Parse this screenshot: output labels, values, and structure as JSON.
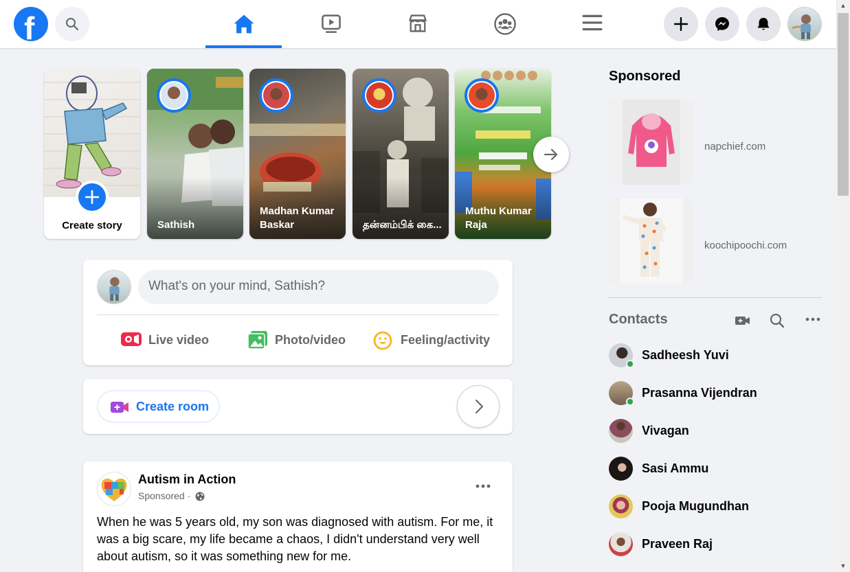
{
  "topbar": {
    "logo_letter": "f",
    "nav": [
      {
        "name": "home",
        "active": true
      },
      {
        "name": "watch",
        "active": false
      },
      {
        "name": "marketplace",
        "active": false
      },
      {
        "name": "groups",
        "active": false
      },
      {
        "name": "menu",
        "active": false
      }
    ],
    "accent": "#1877f2"
  },
  "stories": {
    "create_label": "Create story",
    "items": [
      {
        "name": "Sathish"
      },
      {
        "name": "Madhan Kumar Baskar"
      },
      {
        "name": "தன்னம்பிக் கை..."
      },
      {
        "name": "Muthu Kumar Raja"
      }
    ]
  },
  "composer": {
    "placeholder": "What's on your mind, Sathish?",
    "actions": [
      {
        "label": "Live video",
        "icon": "live-video-icon"
      },
      {
        "label": "Photo/video",
        "icon": "photo-video-icon"
      },
      {
        "label": "Feeling/activity",
        "icon": "feeling-icon"
      }
    ]
  },
  "rooms": {
    "create_label": "Create room"
  },
  "post": {
    "page_name": "Autism in Action",
    "sponsored": "Sponsored ·",
    "text": "When he was 5 years old, my son was diagnosed with autism. For me, it was a big scare, my life became a chaos, I didn't understand very well about autism, so it was something new for me."
  },
  "sidebar": {
    "sponsored_title": "Sponsored",
    "ads": [
      {
        "domain": "napchief.com"
      },
      {
        "domain": "koochipoochi.com"
      }
    ],
    "contacts_title": "Contacts",
    "contacts": [
      {
        "name": "Sadheesh Yuvi",
        "online": true
      },
      {
        "name": "Prasanna Vijendran",
        "online": true
      },
      {
        "name": "Vivagan",
        "online": false
      },
      {
        "name": "Sasi Ammu",
        "online": false
      },
      {
        "name": "Pooja Mugundhan",
        "online": false
      },
      {
        "name": "Praveen Raj",
        "online": false
      }
    ]
  }
}
